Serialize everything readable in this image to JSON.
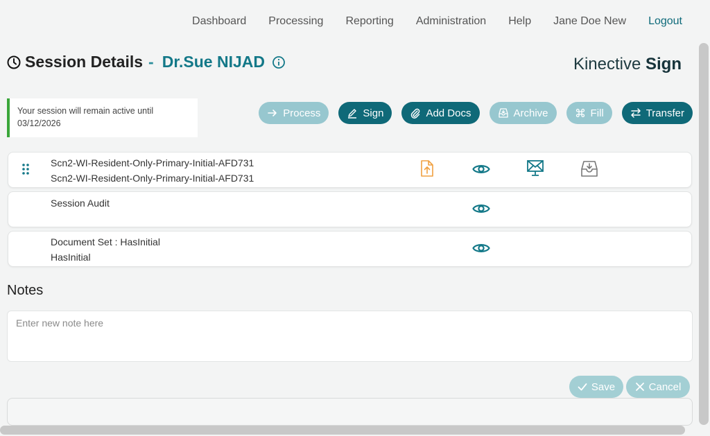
{
  "nav": {
    "items": [
      "Dashboard",
      "Processing",
      "Reporting",
      "Administration",
      "Help",
      "Jane Doe New"
    ],
    "logout": "Logout"
  },
  "header": {
    "title": "Session Details",
    "separator": "-",
    "patient_name": "Dr.Sue NIJAD",
    "brand_light": "Kinective",
    "brand_bold": "Sign"
  },
  "session": {
    "message_line1": "Your session will remain active until",
    "message_line2": "03/12/2026"
  },
  "actions": {
    "process": "Process",
    "sign": "Sign",
    "add_docs": "Add Docs",
    "archive": "Archive",
    "fill": "Fill",
    "transfer": "Transfer"
  },
  "documents": [
    {
      "line1": "Scn2-WI-Resident-Only-Primary-Initial-AFD731",
      "line2": "Scn2-WI-Resident-Only-Primary-Initial-AFD731"
    },
    {
      "line1": "Session Audit",
      "line2": ""
    },
    {
      "line1": "Document Set : HasInitial",
      "line2": "HasInitial"
    }
  ],
  "notes": {
    "title": "Notes",
    "placeholder": "Enter new note here",
    "save": "Save",
    "cancel": "Cancel"
  },
  "colors": {
    "primary": "#0f6978",
    "primary_light": "#97c7cf",
    "accent_green": "#3aa63a",
    "upload_orange": "#f0a040"
  },
  "icons": [
    "clock-icon",
    "info-icon",
    "arrow-right-icon",
    "pen-icon",
    "paperclip-icon",
    "archive-icon",
    "command-icon",
    "transfer-icon",
    "drag-handle-icon",
    "upload-file-icon",
    "eye-icon",
    "email-monitor-icon",
    "inbox-download-icon",
    "check-icon",
    "close-icon"
  ]
}
